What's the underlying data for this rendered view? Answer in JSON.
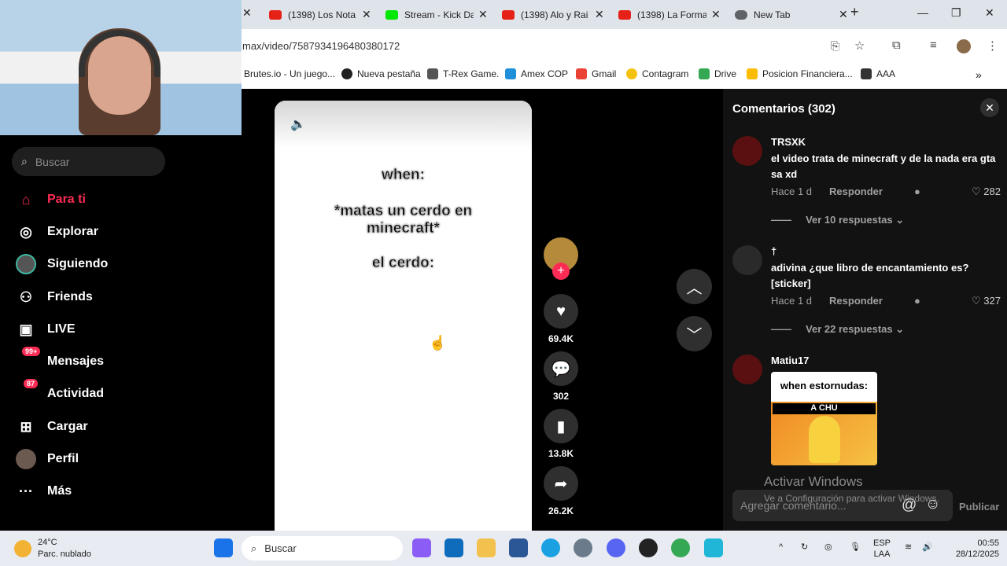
{
  "browser": {
    "tabs": [
      {
        "label": "(1398) Los Nota",
        "color": "#e62117"
      },
      {
        "label": "Stream - Kick Da",
        "color": "#00e701"
      },
      {
        "label": "(1398) Alo y Rai",
        "color": "#e62117"
      },
      {
        "label": "(1398) La Forma",
        "color": "#e62117"
      },
      {
        "label": "New Tab",
        "color": "#5f6368"
      }
    ],
    "new_tab": "+",
    "url": "max/video/7587934196480380172",
    "bookmarks": [
      "Brutes.io - Un juego...",
      "Nueva pestaña",
      "T-Rex Game.",
      "Amex COP",
      "Gmail",
      "Contagram",
      "Drive",
      "Posicion Financiera...",
      "AAA"
    ]
  },
  "sidebar": {
    "search_placeholder": "Buscar",
    "items": [
      {
        "label": "Para ti",
        "icon": "home-icon",
        "glyph": "⌂"
      },
      {
        "label": "Explorar",
        "icon": "compass-icon",
        "glyph": "◎"
      },
      {
        "label": "Siguiendo",
        "icon": "following-avatar-icon",
        "glyph": "●"
      },
      {
        "label": "Friends",
        "icon": "friends-icon",
        "glyph": "⚇"
      },
      {
        "label": "LIVE",
        "icon": "live-icon",
        "glyph": "▣"
      },
      {
        "label": "Mensajes",
        "icon": "messages-icon",
        "glyph": "✉",
        "badge": "99+"
      },
      {
        "label": "Actividad",
        "icon": "activity-icon",
        "glyph": "✉",
        "badge": "87"
      },
      {
        "label": "Cargar",
        "icon": "upload-icon",
        "glyph": "⊞"
      },
      {
        "label": "Perfil",
        "icon": "profile-avatar-icon",
        "glyph": "●"
      },
      {
        "label": "Más",
        "icon": "more-icon",
        "glyph": "···"
      }
    ]
  },
  "video": {
    "lines": [
      "when:",
      "*matas un cerdo en minecraft*",
      "el cerdo:"
    ],
    "likes": "69.4K",
    "comments": "302",
    "saves": "13.8K",
    "shares": "26.2K"
  },
  "comments_panel": {
    "title": "Comentarios (302)",
    "comments": [
      {
        "user": "TRSXK",
        "text": "el video trata de minecraft y de la nada era gta sa xd",
        "time": "Hace 1 d",
        "reply": "Responder",
        "likes": "282",
        "more": "Ver 10 respuestas"
      },
      {
        "user": "†",
        "text": "adivina ¿que libro de encantamiento es? [sticker]",
        "time": "Hace 1 d",
        "reply": "Responder",
        "likes": "327",
        "more": "Ver 22 respuestas"
      },
      {
        "user": "Matiu17",
        "sticker_text": "when estornudas:",
        "sticker_sub": "A CHU"
      }
    ],
    "input_placeholder": "Agregar comentario...",
    "publish": "Publicar",
    "watermark_title": "Activar Windows",
    "watermark_sub": "Ve a Configuración para activar Windows."
  },
  "taskbar": {
    "weather_temp": "24°C",
    "weather_desc": "Parc. nublado",
    "search": "Buscar",
    "lang": "ESP",
    "lang2": "LAA",
    "time": "00:55",
    "date": "28/12/2025"
  },
  "colors": {
    "accent": "#fe2c55",
    "panel": "#121212"
  }
}
